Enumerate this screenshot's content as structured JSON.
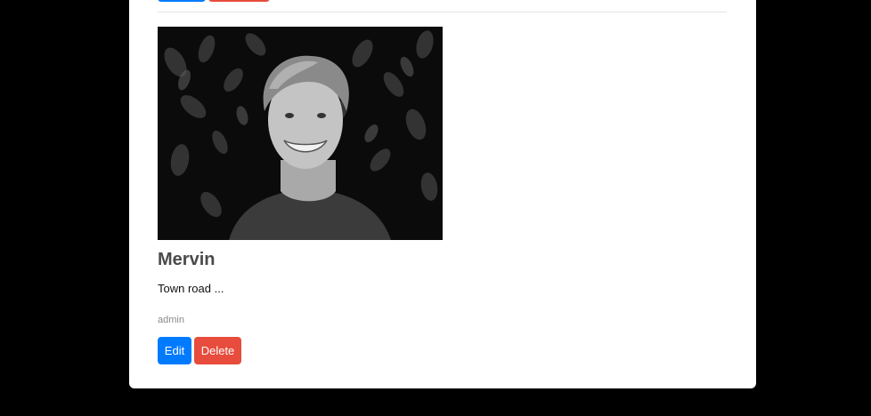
{
  "post": {
    "title": "Mervin",
    "body": "Town road ...",
    "author": "admin",
    "photo_alt": "Mervin"
  },
  "actions": {
    "edit_label": "Edit",
    "delete_label": "Delete"
  },
  "colors": {
    "edit": "#007bff",
    "delete": "#e74c3c",
    "page_background": "#000000",
    "card_background": "#ffffff"
  }
}
